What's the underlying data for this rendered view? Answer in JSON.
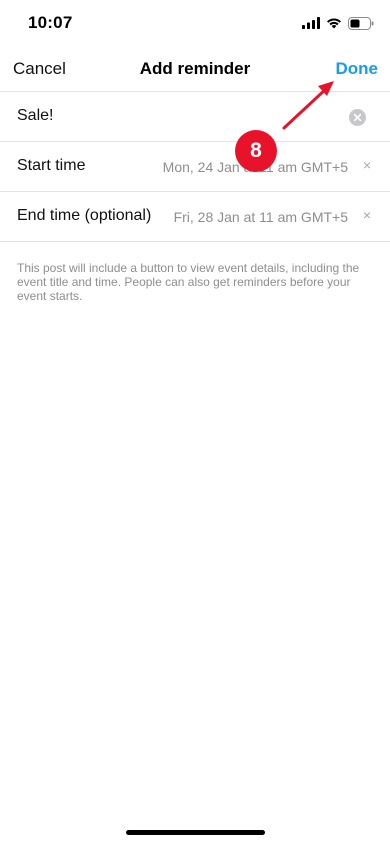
{
  "status_bar": {
    "time": "10:07",
    "icons": [
      "signal-icon",
      "wifi-icon",
      "battery-icon"
    ]
  },
  "nav": {
    "cancel": "Cancel",
    "title": "Add reminder",
    "done": "Done"
  },
  "form": {
    "name_value": "Sale!",
    "start_label": "Start time",
    "start_value": "Mon, 24 Jan at 11 am GMT+5",
    "end_label": "End time (optional)",
    "end_value": "Fri, 28 Jan at 11 am GMT+5",
    "clear_glyph": "×"
  },
  "info": "This post will include a button to view event details, including the event title and time. People can also get reminders before your event starts.",
  "annotation": {
    "step": "8"
  },
  "colors": {
    "accent": "#1a9bf0",
    "annotation": "#e8132b",
    "secondary_text": "#8e8e8e",
    "divider": "#e3e3e3"
  }
}
